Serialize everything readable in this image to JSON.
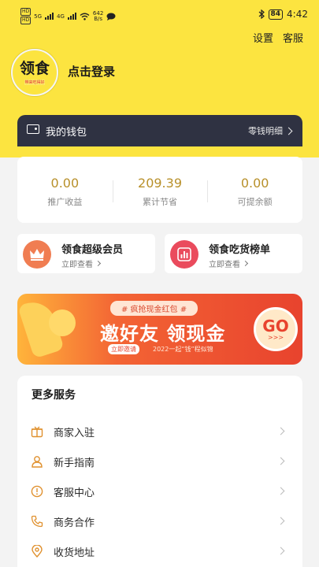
{
  "statusbar": {
    "left_tags": [
      "HD",
      "HD"
    ],
    "net1": "5G",
    "net2": "4G",
    "speed_value": "642",
    "speed_unit": "B/s",
    "battery": "84",
    "time": "4:42"
  },
  "header": {
    "settings": "设置",
    "customer_service": "客服",
    "logo_text": "领食",
    "logo_sub": "带来吃得好",
    "login": "点击登录"
  },
  "wallet": {
    "title": "我的钱包",
    "detail": "零钱明细"
  },
  "stats": [
    {
      "value": "0.00",
      "label": "推广收益"
    },
    {
      "value": "209.39",
      "label": "累计节省"
    },
    {
      "value": "0.00",
      "label": "可提余额"
    }
  ],
  "cards": {
    "member": {
      "title": "领食超级会员",
      "sub": "立即查看"
    },
    "rank": {
      "title": "领食吃货榜单",
      "sub": "立即查看"
    }
  },
  "banner": {
    "top": "# 疯抢现金红包 #",
    "title": "邀好友 领现金",
    "button": "立即邀请",
    "sub": "2022一起“钱”程似锦",
    "go": "GO",
    "go_arrows": ">>>"
  },
  "services": {
    "title": "更多服务",
    "items": [
      {
        "label": "商家入驻",
        "icon": "store-icon"
      },
      {
        "label": "新手指南",
        "icon": "user-icon"
      },
      {
        "label": "客服中心",
        "icon": "info-icon"
      },
      {
        "label": "商务合作",
        "icon": "phone-icon"
      },
      {
        "label": "收货地址",
        "icon": "location-icon"
      }
    ]
  },
  "colors": {
    "brand_yellow": "#fce440",
    "wallet_dark": "#2f3242",
    "stat_gold": "#b8902a",
    "banner_red": "#e8432e"
  }
}
